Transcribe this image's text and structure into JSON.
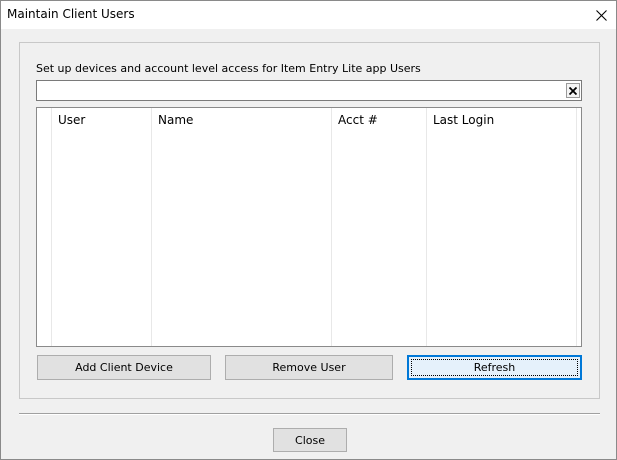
{
  "window": {
    "title": "Maintain Client Users"
  },
  "panel": {
    "description": "Set up devices and account level access for Item Entry Lite app Users",
    "search_value": ""
  },
  "grid": {
    "columns": [
      {
        "key": "user",
        "label": "User"
      },
      {
        "key": "name",
        "label": "Name"
      },
      {
        "key": "acct",
        "label": "Acct #"
      },
      {
        "key": "last_login",
        "label": "Last Login"
      }
    ],
    "rows": []
  },
  "buttons": {
    "add_client_device": "Add Client Device",
    "remove_user": "Remove User",
    "refresh": "Refresh",
    "close": "Close"
  },
  "icons": {
    "window_close": "close-icon",
    "clear_search": "clear-icon"
  }
}
